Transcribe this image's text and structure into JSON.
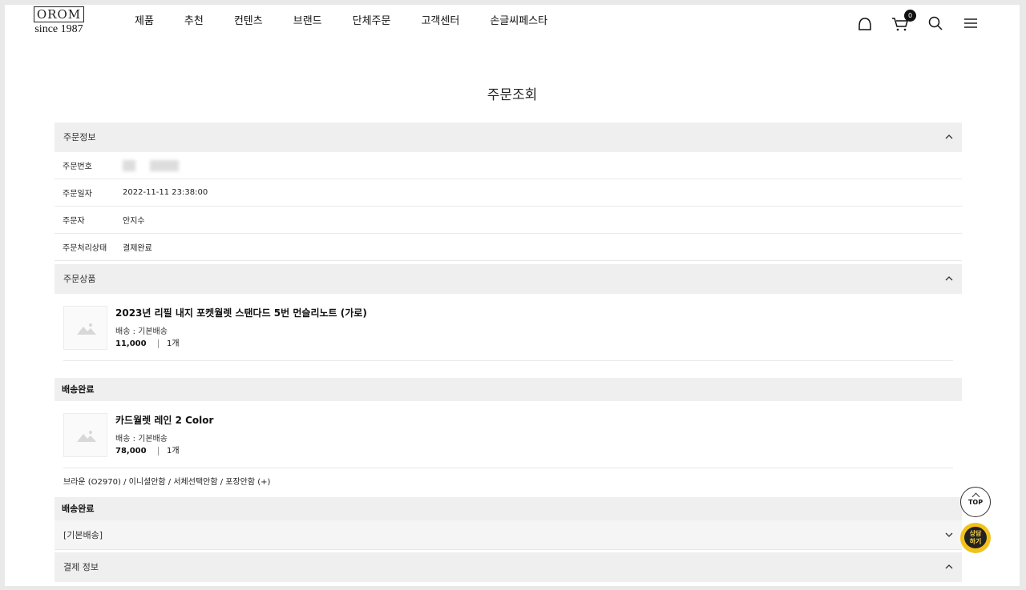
{
  "brand": {
    "logo_word": "OROM",
    "since": "since 1987"
  },
  "gnb": [
    "제품",
    "추천",
    "컨텐츠",
    "브랜드",
    "단체주문",
    "고객센터",
    "손글씨페스타"
  ],
  "cart_count": "0",
  "page_title": "주문조회",
  "order_info": {
    "title": "주문정보",
    "rows": [
      {
        "label": "주문번호",
        "value": ""
      },
      {
        "label": "주문일자",
        "value": "2022-11-11 23:38:00"
      },
      {
        "label": "주문자",
        "value": "안지수"
      },
      {
        "label": "주문처리상태",
        "value": "결제완료"
      }
    ]
  },
  "order_items": {
    "title": "주문상품",
    "item1": {
      "name": "2023년 리필 내지 포켓월렛 스탠다드 5번 먼슬리노트 (가로)",
      "shipping": "배송 : 기본배송",
      "price": "11,000",
      "qty": "1개"
    },
    "status1": "배송완료",
    "item2": {
      "name": "카드월렛 레인 2 Color",
      "shipping": "배송 : 기본배송",
      "price": "78,000",
      "qty": "1개"
    },
    "option2": "브라운 (O2970) / 이니셜안함 / 서체선택안함 / 포장안함 (+)",
    "status2": "배송완료",
    "delivery_group": "[기본배송]"
  },
  "payment": {
    "title": "결제 정보"
  },
  "floating": {
    "top": "TOP",
    "chat_line1": "상담",
    "chat_line2": "하기"
  }
}
